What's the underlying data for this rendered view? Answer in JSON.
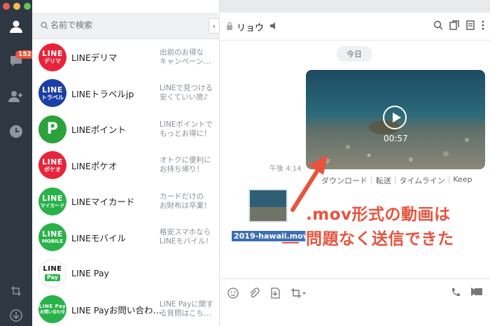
{
  "rail": {
    "badge_count": "152",
    "traffic_colors": [
      "#ec5e55",
      "#f4be4f",
      "#62c554"
    ]
  },
  "search": {
    "placeholder": "名前で検索"
  },
  "chats": [
    {
      "name": "LINEデリマ",
      "snippet": "出前のお得な\nキャンペーン…",
      "avatar_top": "LINE",
      "avatar_bottom": "デリマ",
      "avatar_color": "#e8233a"
    },
    {
      "name": "LINEトラベルjp",
      "snippet": "LINEで見つける\n安くていい旅♪",
      "avatar_top": "LINE",
      "avatar_bottom": "トラベル",
      "avatar_color": "#1a3fa6"
    },
    {
      "name": "LINEポイント",
      "snippet": "LINEポイントで\nもっとお得に！",
      "avatar_top": "P",
      "avatar_bottom": "",
      "avatar_color": "#2aa23e"
    },
    {
      "name": "LINEポケオ",
      "snippet": "オトクに便利に\nお持ち帰り！",
      "avatar_top": "LINE",
      "avatar_bottom": "ポケオ",
      "avatar_color": "#e8233a"
    },
    {
      "name": "LINEマイカード",
      "snippet": "カードだけの\nお財布は卒業！",
      "avatar_top": "LINE",
      "avatar_bottom": "マイカード",
      "avatar_color": "#2ab24a"
    },
    {
      "name": "LINEモバイル",
      "snippet": "格安スマホなら\nLINEモバイル！",
      "avatar_top": "LINE",
      "avatar_bottom": "MOBILE",
      "avatar_color": "#2ab24a"
    },
    {
      "name": "LINE Pay",
      "snippet": "",
      "avatar_top": "LINE",
      "avatar_bottom": "Pay",
      "avatar_color": "#ffffff"
    },
    {
      "name": "LINE Payお問い合わ…",
      "snippet": "LINE Payに関す\nる質問はこち…",
      "avatar_top": "LINE Pay",
      "avatar_bottom": "お問い合わせ",
      "avatar_color": "#2ab24a"
    }
  ],
  "header": {
    "name": "リョウ"
  },
  "body": {
    "date": "今日",
    "video_duration": "00:57",
    "time": "午後 4:14",
    "actions": [
      "ダウンロード",
      "転送",
      "タイムライン",
      "Keep"
    ],
    "file_name": "2019-hawaii.mov",
    "callout_line1": ".mov形式の動画は",
    "callout_line2": "問題なく送信できた"
  },
  "colors": {
    "accent": "#e8533c",
    "rail": "#2e3742",
    "line_green": "#2ab24a"
  }
}
